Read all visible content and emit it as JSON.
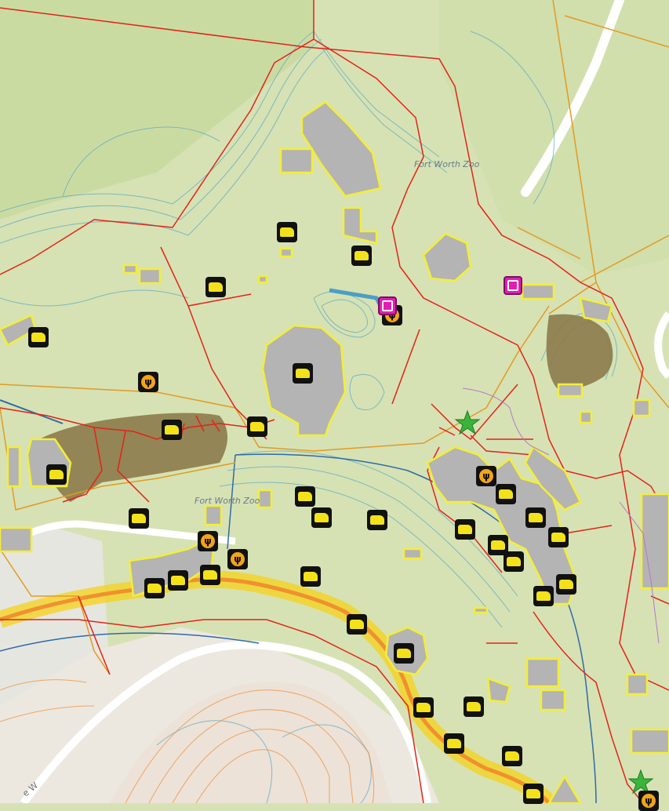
{
  "map": {
    "labels": {
      "zoo_north": "Fort Worth Zoo",
      "zoo_south": "Fort Worth Zoo",
      "street": "e W"
    },
    "colors": {
      "background": "#d6e2b4",
      "forest": "#c8dba0",
      "building": "#b4b4b4",
      "building_outline": "#f4ee38",
      "trail": "#e2231a",
      "boundary": "#e39a22",
      "contour": "#5aa6c2",
      "water_brown": "#8c7b4a",
      "river": "#2f6aa5",
      "road": "#ffffff",
      "heat_yellow": "#f6d21a",
      "heat_orange": "#f08a2b",
      "marker_star": "#3ab43c",
      "gift_pink": "#e01fb4"
    },
    "icons": {
      "animal": "animal-icon",
      "food": "restaurant-icon",
      "gift": "gift-shop-icon",
      "viewpoint": "star-marker-icon"
    }
  }
}
